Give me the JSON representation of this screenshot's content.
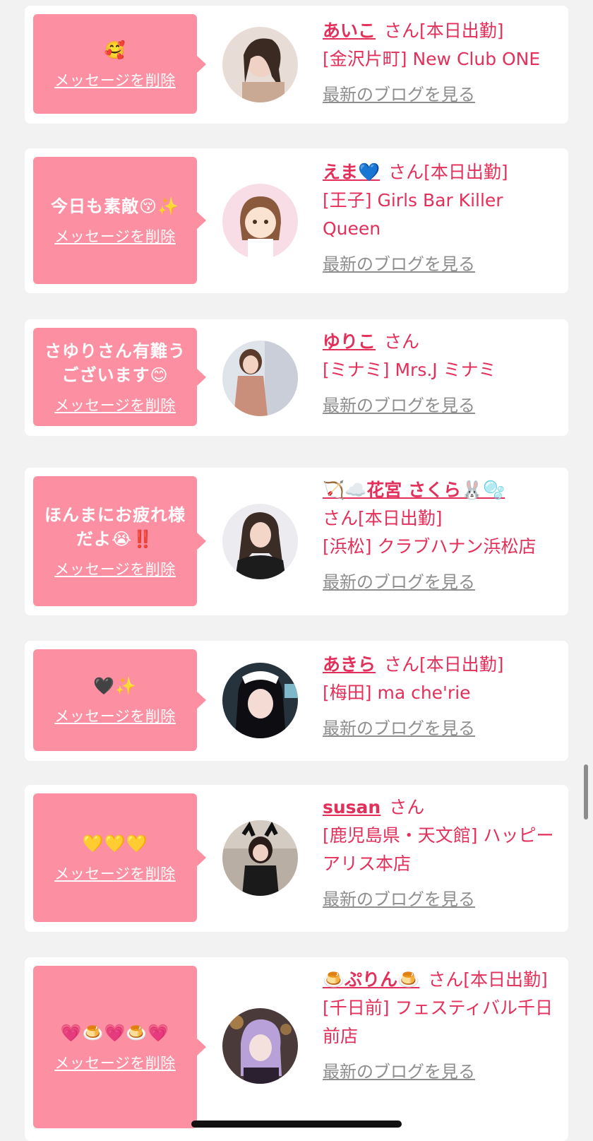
{
  "delete_label": "メッセージを削除",
  "blog_label": "最新のブログを見る",
  "san_label": "さん",
  "working_label": "[本日出勤]",
  "cards": [
    {
      "message": "🥰",
      "name": "あいこ",
      "area": "[金沢片町]",
      "shop": "New Club ONE",
      "working": true
    },
    {
      "message": "今日も素敵😚✨",
      "name": "えま💙",
      "area": "[王子]",
      "shop": "Girls Bar Killer Queen",
      "working": true
    },
    {
      "message": "さゆりさん有難うございます😊",
      "name": "ゆりこ",
      "area": "[ミナミ]",
      "shop": "Mrs.J ミナミ",
      "working": false
    },
    {
      "message": "ほんまにお疲れ様だよ😭‼️",
      "name": "🏹☁️花宮 さくら🐰🫧",
      "area": "[浜松]",
      "shop": "クラブハナン浜松店",
      "working": true
    },
    {
      "message": "🖤✨",
      "name": "あきら",
      "area": "[梅田]",
      "shop": "ma che'rie",
      "working": true
    },
    {
      "message": "💛💛💛",
      "name": "susan",
      "area": "[鹿児島県・天文館]",
      "shop": "ハッピーアリス本店",
      "working": false
    },
    {
      "message": "💗🍮💗🍮💗",
      "name": "🍮ぷりん🍮",
      "area": "[千日前]",
      "shop": "フェスティバル千日前店",
      "working": true
    }
  ],
  "colors": {
    "accent": "#e3305b",
    "bubble": "#fd8fa2",
    "page_bg": "#f2f2f2",
    "muted": "#8e8e8e"
  }
}
